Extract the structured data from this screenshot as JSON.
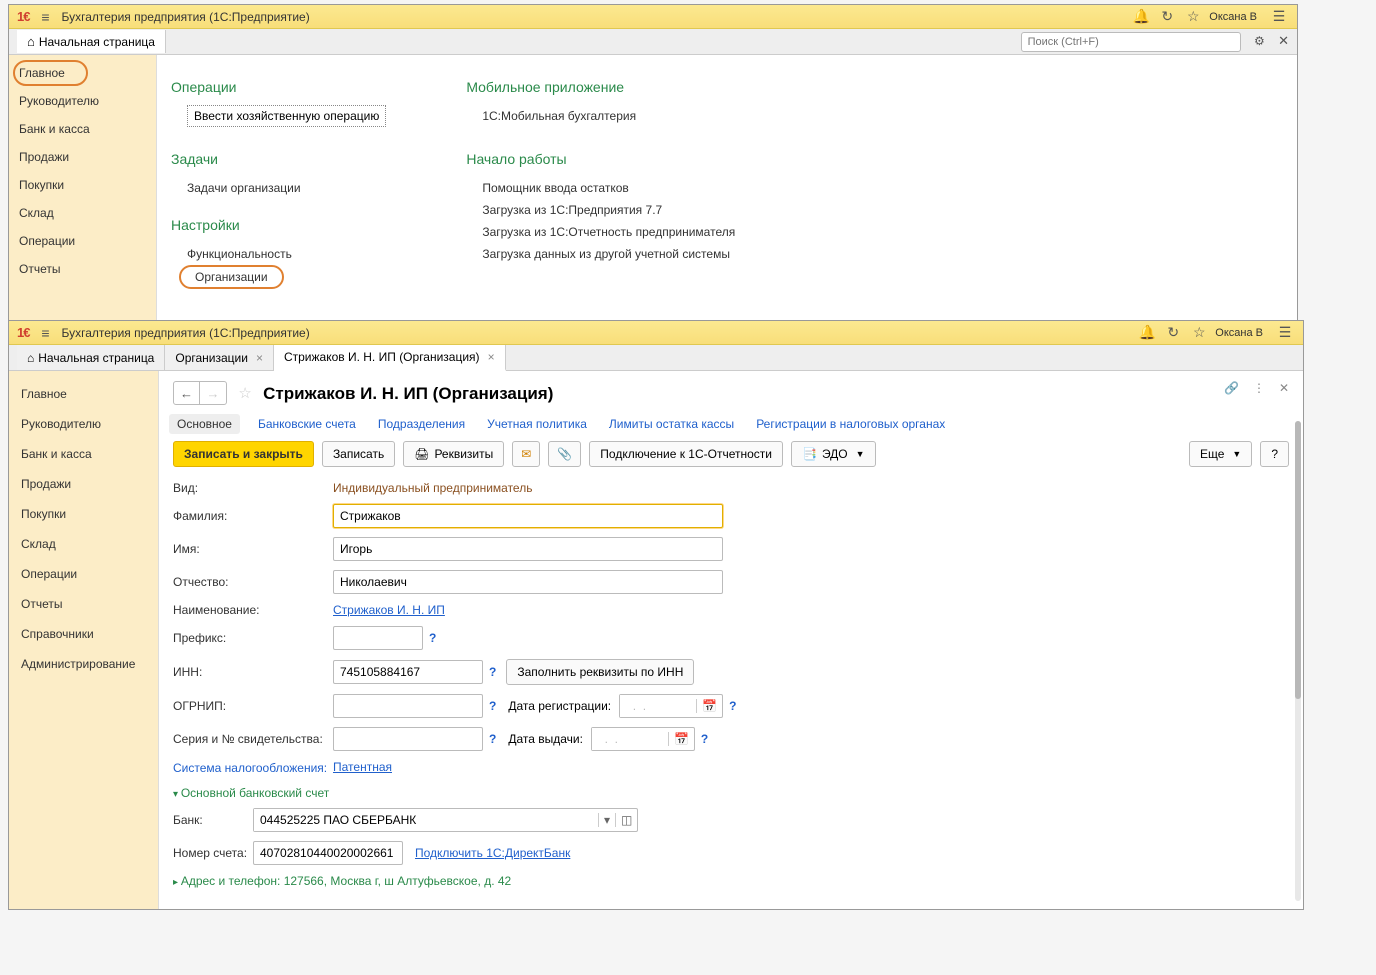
{
  "app": {
    "title": "Бухгалтерия предприятия  (1С:Предприятие)",
    "user": "Оксана В"
  },
  "home_tab": "Начальная страница",
  "search_placeholder": "Поиск (Ctrl+F)",
  "sidebar": {
    "items": [
      "Главное",
      "Руководителю",
      "Банк и касса",
      "Продажи",
      "Покупки",
      "Склад",
      "Операции",
      "Отчеты",
      "Справочники",
      "Администрирование"
    ]
  },
  "panel1": {
    "col1": {
      "sec1_title": "Операции",
      "sec1_link": "Ввести хозяйственную операцию",
      "sec2_title": "Задачи",
      "sec2_link": "Задачи организации",
      "sec3_title": "Настройки",
      "sec3_link1": "Функциональность",
      "sec3_link2": "Организации"
    },
    "col2": {
      "secA_title": "Мобильное приложение",
      "secA_link": "1С:Мобильная бухгалтерия",
      "secB_title": "Начало работы",
      "secB_links": [
        "Помощник ввода остатков",
        "Загрузка из 1С:Предприятия 7.7",
        "Загрузка из 1С:Отчетность предпринимателя",
        "Загрузка данных из другой учетной системы"
      ]
    }
  },
  "tabs2": {
    "tab0": "Начальная страница",
    "tab1": "Организации",
    "tab2": "Стрижаков И. Н. ИП (Организация)"
  },
  "page": {
    "title": "Стрижаков И. Н. ИП (Организация)",
    "subtabs": [
      "Основное",
      "Банковские счета",
      "Подразделения",
      "Учетная политика",
      "Лимиты остатка кассы",
      "Регистрации в налоговых органах"
    ],
    "toolbar": {
      "save_close": "Записать и закрыть",
      "save": "Записать",
      "requisites": "Реквизиты",
      "connect_report": "Подключение к 1С-Отчетности",
      "edo": "ЭДО",
      "more": "Еще",
      "help": "?"
    },
    "form": {
      "vid_label": "Вид:",
      "vid_value": "Индивидуальный предприниматель",
      "fam_label": "Фамилия:",
      "fam_value": "Стрижаков",
      "name_label": "Имя:",
      "name_value": "Игорь",
      "otch_label": "Отчество:",
      "otch_value": "Николаевич",
      "naim_label": "Наименование:",
      "naim_value": "Стрижаков И. Н. ИП",
      "prefix_label": "Префикс:",
      "prefix_value": "",
      "inn_label": "ИНН:",
      "inn_value": "745105884167",
      "fill_inn_btn": "Заполнить реквизиты по ИНН",
      "ogrnip_label": "ОГРНИП:",
      "ogrnip_value": "",
      "date_reg_label": "Дата регистрации:",
      "date_reg_value": "  .  .",
      "seria_label": "Серия и № свидетельства:",
      "seria_value": "",
      "date_issue_label": "Дата выдачи:",
      "date_issue_value": "  .  .",
      "tax_sys_label": "Система налогообложения:",
      "tax_sys_value": "Патентная",
      "exp_bank": "Основной банковский счет",
      "bank_label": "Банк:",
      "bank_value": "044525225 ПАО СБЕРБАНК",
      "acct_label": "Номер счета:",
      "acct_value": "40702810440020002661",
      "directbank": "Подключить 1С:ДиректБанк",
      "addr_line": "Адрес и телефон: 127566, Москва г, ш Алтуфьевское, д. 42"
    }
  }
}
